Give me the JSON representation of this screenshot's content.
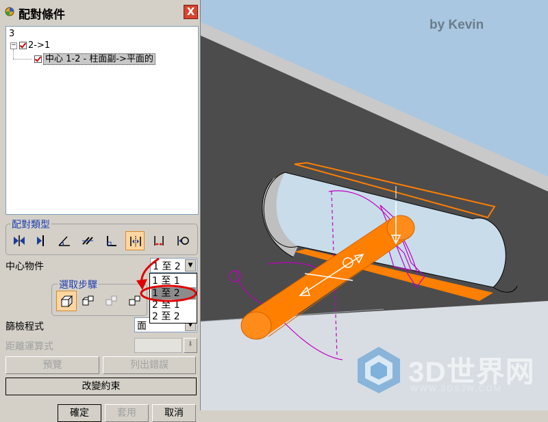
{
  "dialog": {
    "title": "配對條件",
    "close_label": "X"
  },
  "tree": {
    "count": "3",
    "group_label": "2->1",
    "item_label": "中心 1-2 - 柱面副->平面的"
  },
  "mate_type": {
    "label": "配對類型",
    "icons": [
      "mate-icon",
      "align-icon",
      "angle-icon",
      "parallel-icon",
      "perpendicular-icon",
      "center-icon",
      "distance-icon",
      "tangent-icon"
    ],
    "active_index": 5
  },
  "center_object": {
    "label": "中心物件",
    "value": "1 至 2",
    "options": [
      "1 至 1",
      "1 至 2",
      "2 至 1",
      "2 至 2"
    ],
    "highlighted_option": "1 至 2"
  },
  "selection_steps": {
    "label": "選取步驟",
    "active_index": 0
  },
  "filter": {
    "label": "篩檢程式",
    "value": "面"
  },
  "distance_expr": {
    "label": "距離運算式",
    "value": ""
  },
  "buttons": {
    "preview": "預覽",
    "list_errors": "列出錯誤",
    "change_constraint": "改變約束",
    "ok": "確定",
    "apply": "套用",
    "cancel": "取消"
  },
  "viewport": {
    "byline": "by Kevin",
    "watermark": "3D世界网",
    "watermark_url": "WWW.3DSJW.COM"
  },
  "colors": {
    "accent_orange": "#ff7f00",
    "constraint_magenta": "#c000c0",
    "annotation_red": "#e00000",
    "panel_bg": "#d4d0c8"
  }
}
